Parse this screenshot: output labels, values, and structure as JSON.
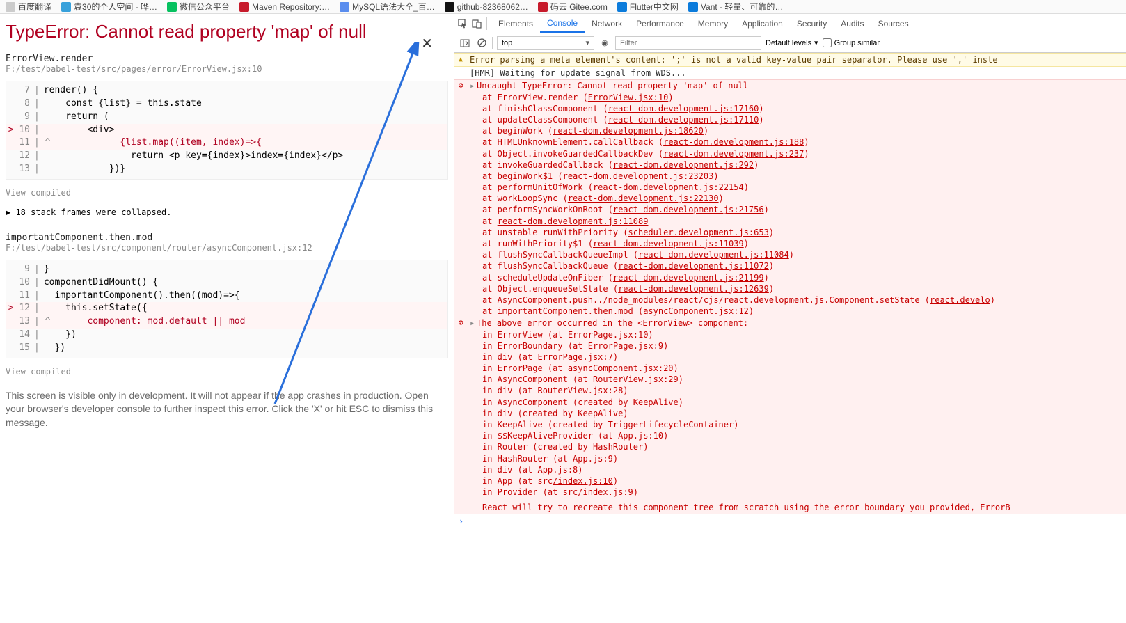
{
  "bookmarks": [
    {
      "label": "百度翻译",
      "color": "#ccc"
    },
    {
      "label": "袁30的个人空间 - 哗…",
      "color": "#38a1db"
    },
    {
      "label": "微信公众平台",
      "color": "#07c160"
    },
    {
      "label": "Maven Repository:…",
      "color": "#c71b2c"
    },
    {
      "label": "MySQL语法大全_百…",
      "color": "#5a8dee"
    },
    {
      "label": "github-82368062…",
      "color": "#111"
    },
    {
      "label": "码云 Gitee.com",
      "color": "#c71b2c"
    },
    {
      "label": "Flutter中文网",
      "color": "#0b7bdb"
    },
    {
      "label": "Vant - 轻量、可靠的…",
      "color": "#0b7bdb"
    }
  ],
  "error_title": "TypeError: Cannot read property 'map' of null",
  "stack1_head": "ErrorView.render",
  "stack1_path": "F:/test/babel-test/src/pages/error/ErrorView.jsx:10",
  "code1": [
    {
      "n": "7",
      "hl": false,
      "caret": false,
      "text": "render() {"
    },
    {
      "n": "8",
      "hl": false,
      "caret": false,
      "text": "    const {list} = this.state"
    },
    {
      "n": "9",
      "hl": false,
      "caret": false,
      "text": "    return ("
    },
    {
      "n": "10",
      "hl": true,
      "caret": false,
      "text": "        <div>"
    },
    {
      "n": "11",
      "hl": false,
      "caret": true,
      "text": "            {list.map((item, index)=>{"
    },
    {
      "n": "12",
      "hl": false,
      "caret": false,
      "text": "                return <p key={index}>index={index}</p>"
    },
    {
      "n": "13",
      "hl": false,
      "caret": false,
      "text": "            })}"
    }
  ],
  "view_compiled": "View compiled",
  "collapsed_frames": "18 stack frames were collapsed.",
  "stack2_head": "importantComponent.then.mod",
  "stack2_path": "F:/test/babel-test/src/component/router/asyncComponent.jsx:12",
  "code2": [
    {
      "n": "9",
      "hl": false,
      "caret": false,
      "text": "}"
    },
    {
      "n": "10",
      "hl": false,
      "caret": false,
      "text": "componentDidMount() {"
    },
    {
      "n": "11",
      "hl": false,
      "caret": false,
      "text": "  importantComponent().then((mod)=>{"
    },
    {
      "n": "12",
      "hl": true,
      "caret": false,
      "text": "    this.setState({"
    },
    {
      "n": "13",
      "hl": false,
      "caret": true,
      "text": "      component: mod.default || mod"
    },
    {
      "n": "14",
      "hl": false,
      "caret": false,
      "text": "    })"
    },
    {
      "n": "15",
      "hl": false,
      "caret": false,
      "text": "  })"
    }
  ],
  "dev_footer": "This screen is visible only in development. It will not appear if the app crashes in production. Open your browser's developer console to further inspect this error. Click the 'X' or hit ESC to dismiss this message.",
  "dt_tabs": [
    "Elements",
    "Console",
    "Network",
    "Performance",
    "Memory",
    "Application",
    "Security",
    "Audits",
    "Sources"
  ],
  "dt_active_tab_index": 1,
  "dt_context": "top",
  "dt_filter_placeholder": "Filter",
  "dt_levels": "Default levels",
  "dt_group": "Group similar",
  "warn_msg": "Error parsing a meta element's content: ';' is not a valid key-value pair separator. Please use ',' inste",
  "hmr_msg": "[HMR] Waiting for update signal from WDS...",
  "err1_head": "Uncaught TypeError: Cannot read property 'map' of null",
  "err1_stack": [
    {
      "at": "ErrorView.render",
      "link": "ErrorView.jsx:10"
    },
    {
      "at": "finishClassComponent",
      "link": "react-dom.development.js:17160"
    },
    {
      "at": "updateClassComponent",
      "link": "react-dom.development.js:17110"
    },
    {
      "at": "beginWork",
      "link": "react-dom.development.js:18620"
    },
    {
      "at": "HTMLUnknownElement.callCallback",
      "link": "react-dom.development.js:188"
    },
    {
      "at": "Object.invokeGuardedCallbackDev",
      "link": "react-dom.development.js:237"
    },
    {
      "at": "invokeGuardedCallback",
      "link": "react-dom.development.js:292"
    },
    {
      "at": "beginWork$1",
      "link": "react-dom.development.js:23203"
    },
    {
      "at": "performUnitOfWork",
      "link": "react-dom.development.js:22154"
    },
    {
      "at": "workLoopSync",
      "link": "react-dom.development.js:22130"
    },
    {
      "at": "performSyncWorkOnRoot",
      "link": "react-dom.development.js:21756"
    },
    {
      "at": "react-dom.development.js:11089",
      "link": ""
    },
    {
      "at": "unstable_runWithPriority",
      "link": "scheduler.development.js:653"
    },
    {
      "at": "runWithPriority$1",
      "link": "react-dom.development.js:11039"
    },
    {
      "at": "flushSyncCallbackQueueImpl",
      "link": "react-dom.development.js:11084"
    },
    {
      "at": "flushSyncCallbackQueue",
      "link": "react-dom.development.js:11072"
    },
    {
      "at": "scheduleUpdateOnFiber",
      "link": "react-dom.development.js:21199"
    },
    {
      "at": "Object.enqueueSetState",
      "link": "react-dom.development.js:12639"
    },
    {
      "at": "AsyncComponent.push../node_modules/react/cjs/react.development.js.Component.setState",
      "link": "react.develo"
    },
    {
      "at": "importantComponent.then.mod",
      "link": "asyncComponent.jsx:12"
    }
  ],
  "err2_head": "The above error occurred in the <ErrorView> component:",
  "err2_in": [
    "in ErrorView (at ErrorPage.jsx:10)",
    "in ErrorBoundary (at ErrorPage.jsx:9)",
    "in div (at ErrorPage.jsx:7)",
    "in ErrorPage (at asyncComponent.jsx:20)",
    "in AsyncComponent (at RouterView.jsx:29)",
    "in div (at RouterView.jsx:28)",
    "in AsyncComponent (created by KeepAlive)",
    "in div (created by KeepAlive)",
    "in KeepAlive (created by TriggerLifecycleContainer)",
    "in $$KeepAliveProvider (at App.js:10)",
    "in Router (created by HashRouter)",
    "in HashRouter (at App.js:9)",
    "in div (at App.js:8)"
  ],
  "err2_in_linked": [
    {
      "text": "in App (at src",
      "link": "/index.js:10",
      "suffix": ")"
    },
    {
      "text": "in Provider (at src",
      "link": "/index.js:9",
      "suffix": ")"
    }
  ],
  "err2_footer": "React will try to recreate this component tree from scratch using the error boundary you provided, ErrorB",
  "prompt": "›"
}
